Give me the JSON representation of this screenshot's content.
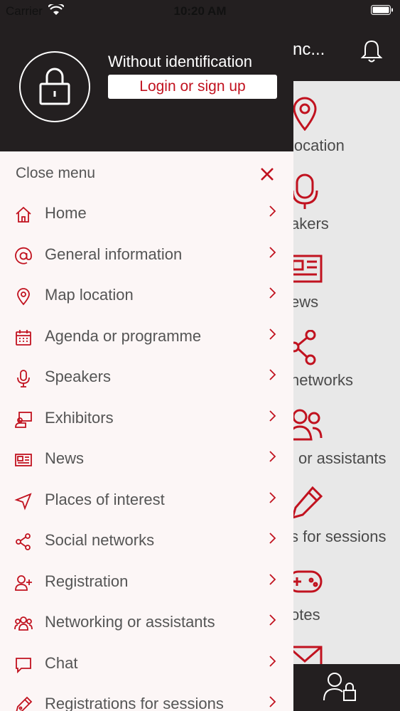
{
  "status_bar": {
    "carrier": "Carrier",
    "time": "10:20 AM"
  },
  "background": {
    "title": "nc...",
    "tiles": [
      {
        "label": "location",
        "icon": "map-pin-icon"
      },
      {
        "label": "akers",
        "icon": "microphone-icon"
      },
      {
        "label": "ews",
        "icon": "newspaper-icon"
      },
      {
        "label": "networks",
        "icon": "share-icon"
      },
      {
        "label": "or assistants",
        "icon": "people-icon"
      },
      {
        "label": "s for sessions",
        "icon": "pen-icon"
      },
      {
        "label": "otes",
        "icon": "gamepad-icon"
      }
    ]
  },
  "drawer": {
    "user_status": "Without identification",
    "login_label": "Login or sign up",
    "close_label": "Close menu",
    "accent_color": "#c1121f",
    "items": [
      {
        "label": "Home",
        "icon": "home-icon"
      },
      {
        "label": "General information",
        "icon": "at-sign-icon"
      },
      {
        "label": "Map location",
        "icon": "map-pin-icon"
      },
      {
        "label": "Agenda or programme",
        "icon": "calendar-icon"
      },
      {
        "label": "Speakers",
        "icon": "microphone-icon"
      },
      {
        "label": "Exhibitors",
        "icon": "exhibitor-icon"
      },
      {
        "label": "News",
        "icon": "newspaper-icon"
      },
      {
        "label": "Places of interest",
        "icon": "navigation-icon"
      },
      {
        "label": "Social networks",
        "icon": "share-icon"
      },
      {
        "label": "Registration",
        "icon": "add-user-icon"
      },
      {
        "label": "Networking or assistants",
        "icon": "people-icon"
      },
      {
        "label": "Chat",
        "icon": "chat-icon"
      },
      {
        "label": "Registrations for sessions",
        "icon": "pen-icon"
      }
    ]
  }
}
